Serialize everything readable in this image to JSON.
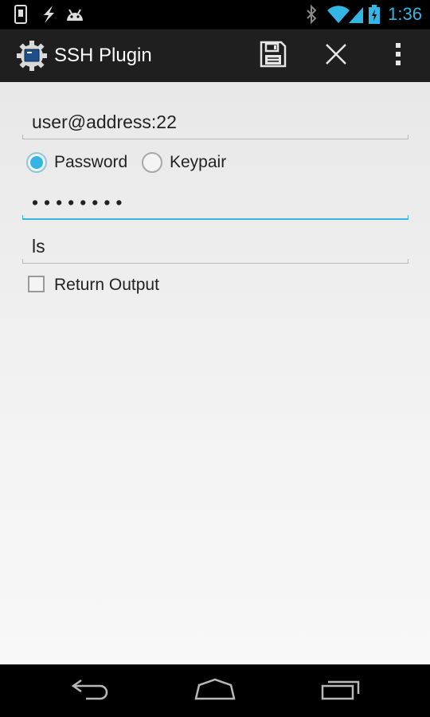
{
  "status_bar": {
    "time": "1:36",
    "icons": [
      "phone-notification-icon",
      "charging-bolt-icon",
      "android-icon",
      "bluetooth-icon",
      "wifi-icon",
      "signal-icon",
      "battery-icon"
    ],
    "accent_color": "#33b5e5"
  },
  "action_bar": {
    "title": "SSH Plugin",
    "icons": [
      "app-gear-icon",
      "save-icon",
      "close-icon",
      "overflow-menu-icon"
    ]
  },
  "form": {
    "host": "user@address:22",
    "auth_options": [
      {
        "label": "Password",
        "selected": true
      },
      {
        "label": "Keypair",
        "selected": false
      }
    ],
    "password_masked": "••••••••",
    "command": "ls",
    "return_output": {
      "label": "Return Output",
      "checked": false
    }
  },
  "nav_bar": {
    "icons": [
      "back-icon",
      "home-icon",
      "recents-icon"
    ]
  }
}
